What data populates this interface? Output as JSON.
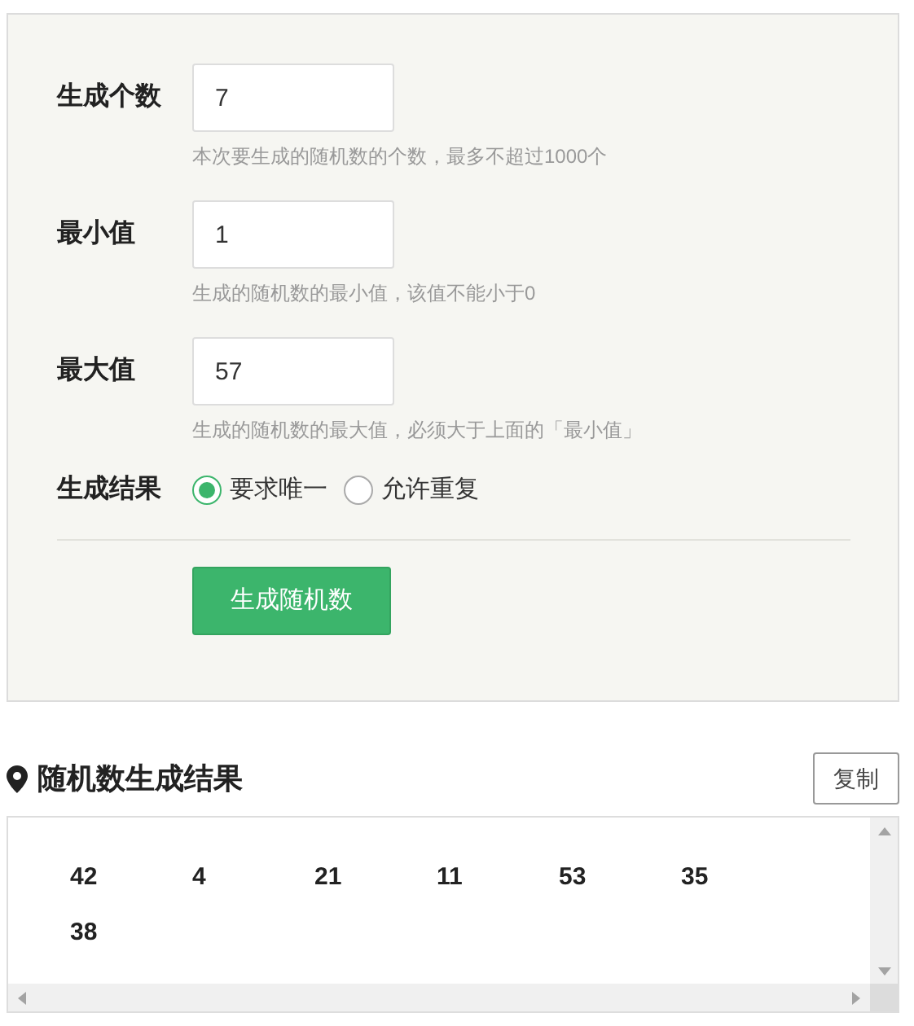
{
  "form": {
    "fields": [
      {
        "label": "生成个数",
        "value": "7",
        "hint": "本次要生成的随机数的个数，最多不超过1000个"
      },
      {
        "label": "最小值",
        "value": "1",
        "hint": "生成的随机数的最小值，该值不能小于0"
      },
      {
        "label": "最大值",
        "value": "57",
        "hint": "生成的随机数的最大值，必须大于上面的「最小值」"
      }
    ],
    "result_mode": {
      "label": "生成结果",
      "options": [
        {
          "label": "要求唯一",
          "selected": true
        },
        {
          "label": "允许重复",
          "selected": false
        }
      ]
    },
    "generate_button": "生成随机数"
  },
  "results": {
    "title": "随机数生成结果",
    "copy_button": "复制",
    "numbers": [
      "42",
      "4",
      "21",
      "11",
      "53",
      "35",
      "38"
    ]
  }
}
